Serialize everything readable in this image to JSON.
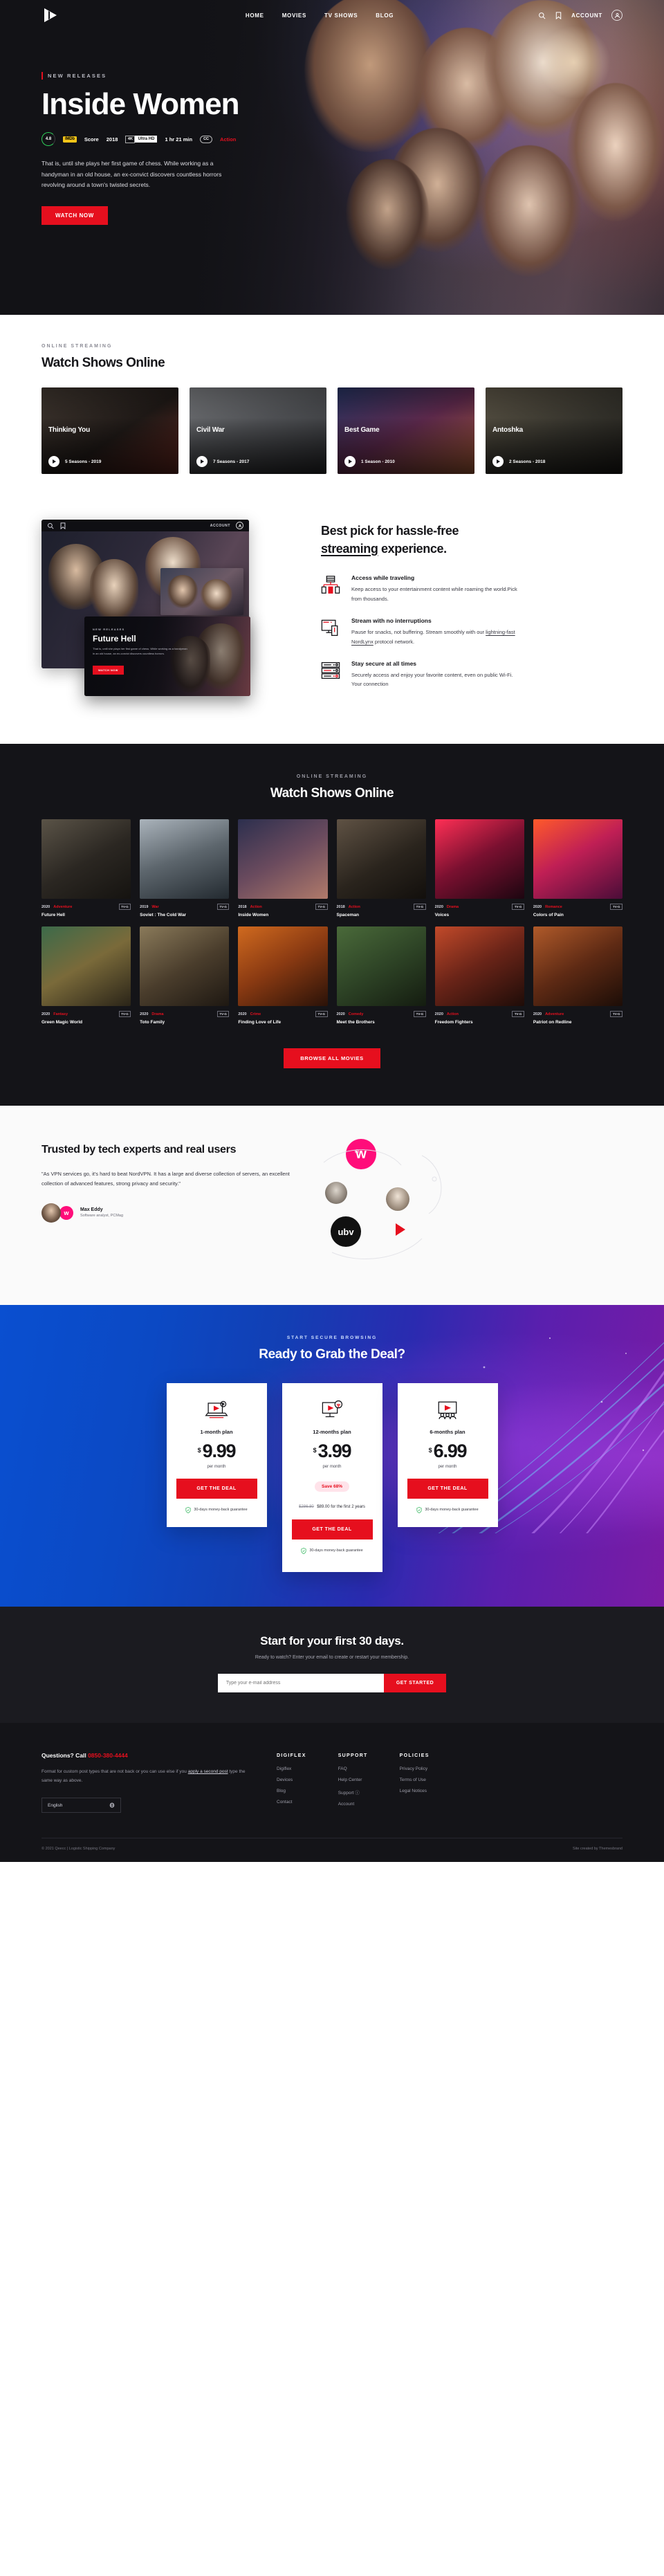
{
  "nav": {
    "logo_name": "play-logo",
    "links": [
      "HOME",
      "MOVIES",
      "TV SHOWS",
      "BLOG"
    ],
    "search_icon": "search-icon",
    "bookmark_icon": "bookmark-icon",
    "account_label": "ACCOUNT",
    "avatar_icon": "user-avatar-icon"
  },
  "hero": {
    "eyebrow": "NEW RELEASES",
    "title": "Inside Women",
    "score": "4.8",
    "imdb_badge": "IMDb",
    "score_label": "Score",
    "year": "2018",
    "quality_key": "4K",
    "quality_value": "Ultra HD",
    "duration": "1 hr 21 min",
    "cc": "CC",
    "genre": "Action",
    "description": "That is, until she plays her first game of chess. While working as a handyman in an old house, an ex-convict discovers countless horrors revolving around a town's twisted secrets.",
    "cta": "WATCH NOW"
  },
  "shows": {
    "eyebrow": "ONLINE STREAMING",
    "title": "Watch Shows Online",
    "cards": [
      {
        "title": "Thinking You",
        "meta": "5 Seasons - 2019"
      },
      {
        "title": "Civil War",
        "meta": "7 Seasons - 2017"
      },
      {
        "title": "Best Game",
        "meta": "1 Season - 2010"
      },
      {
        "title": "Antoshka",
        "meta": "2 Seasons - 2018"
      }
    ]
  },
  "bestpick": {
    "heading_line1": "Best pick for hassle-free",
    "heading_underlined": "streaming",
    "heading_line2_rest": " experience.",
    "device": {
      "search_icon": "search-icon",
      "bookmark_icon": "bookmark-icon",
      "account_label": "ACCOUNT",
      "avatar_icon": "user-avatar-icon",
      "card_eyebrow": "NEW RELEASES",
      "card_title": "Future Hell",
      "card_desc": "That is, until she plays her first game of chess. While working as a handyman in an old house, an ex-convict discovers countless horrors.",
      "card_cta": "WATCH NOW"
    },
    "features": [
      {
        "icon": "network-devices-icon",
        "title": "Access while traveling",
        "text": "Keep access to your entertainment content while roaming the world.Pick from thousands."
      },
      {
        "icon": "monitor-mobile-icon",
        "title": "Stream with no interruptions",
        "text_before": "Pause for snacks, not buffering. Stream smoothly with our ",
        "text_link": "lightning-fast NordLynx",
        "text_after": " protocol network."
      },
      {
        "icon": "server-rack-icon",
        "title": "Stay secure at all times",
        "text": "Securely access and enjoy your favorite content, even on public Wi-Fi. Your connection"
      }
    ]
  },
  "catalog": {
    "eyebrow": "ONLINE STREAMING",
    "title": "Watch Shows Online",
    "items": [
      {
        "year": "2020",
        "genre": "Adventure",
        "rating": "TV-G",
        "name": "Future Hell"
      },
      {
        "year": "2019",
        "genre": "War",
        "rating": "TV-G",
        "name": "Soviet : The Cold War"
      },
      {
        "year": "2018",
        "genre": "Action",
        "rating": "TV-G",
        "name": "Inside Women"
      },
      {
        "year": "2018",
        "genre": "Action",
        "rating": "TV-G",
        "name": "Spaceman"
      },
      {
        "year": "2020",
        "genre": "Drama",
        "rating": "TV-G",
        "name": "Voices"
      },
      {
        "year": "2020",
        "genre": "Romance",
        "rating": "TV-G",
        "name": "Colors of Pain"
      },
      {
        "year": "2020",
        "genre": "Fantasy",
        "rating": "TV-G",
        "name": "Green Magic World"
      },
      {
        "year": "2020",
        "genre": "Drama",
        "rating": "TV-G",
        "name": "Toto Family"
      },
      {
        "year": "2020",
        "genre": "Crime",
        "rating": "TV-G",
        "name": "Finding Love of Life"
      },
      {
        "year": "2020",
        "genre": "Comedy",
        "rating": "TV-G",
        "name": "Meet the Brothers"
      },
      {
        "year": "2020",
        "genre": "Action",
        "rating": "TV-G",
        "name": "Freedom Fighters"
      },
      {
        "year": "2020",
        "genre": "Adventure",
        "rating": "TV-G",
        "name": "Patriot on Redline"
      }
    ],
    "browse_label": "BROWSE ALL MOVIES"
  },
  "trust": {
    "heading": "Trusted by tech experts and real users",
    "quote": "\"As VPN services go, it's hard to beat NordVPN. It has a large and diverse collection of servers, an excellent collection of advanced features, strong privacy and security.\"",
    "person_name": "Max Eddy",
    "person_role": "Software analyst, PCMag",
    "brand_badge_letter": "w",
    "brand_word": "ubv"
  },
  "deal": {
    "eyebrow": "START SECURE BROWSING",
    "title": "Ready to Grab the Deal?",
    "plans": [
      {
        "icon": "laptop-plus-icon",
        "name": "1-month plan",
        "currency": "$",
        "amount": "9.99",
        "per": "per month",
        "cta": "GET THE DEAL",
        "guarantee": "30-days money-back guarantee"
      },
      {
        "icon": "monitor-wifi-icon",
        "name": "12-months plan",
        "currency": "$",
        "amount": "3.99",
        "per": "per month",
        "save": "Save 68%",
        "strike": "$286.80",
        "after": "$89.00 for the first 2 years",
        "cta": "GET THE DEAL",
        "guarantee": "30-days money-back guarantee"
      },
      {
        "icon": "screen-audience-icon",
        "name": "6-months plan",
        "currency": "$",
        "amount": "6.99",
        "per": "per month",
        "cta": "GET THE DEAL",
        "guarantee": "30-days money-back guarantee"
      }
    ]
  },
  "signup": {
    "title": "Start for your first 30 days.",
    "subtitle": "Ready to watch? Enter your email to create or restart your membership.",
    "placeholder": "Type your e-mail address",
    "cta": "GET STARTED"
  },
  "footer": {
    "question": "Questions? Call ",
    "phone": "0850-380-4444",
    "note_before": "Format for custom post types that are not back or you can use else if you ",
    "note_link": "apply a second post",
    "note_after": " type the same way as above.",
    "language": "English",
    "columns": [
      {
        "heading": "DIGIFLEX",
        "links": [
          "Digiflex",
          "Devices",
          "Blog",
          "Contact"
        ]
      },
      {
        "heading": "SUPPORT",
        "links": [
          "FAQ",
          "Help Center",
          "Support ⓘ",
          "Account"
        ]
      },
      {
        "heading": "POLICIES",
        "links": [
          "Privacy Policy",
          "Terms of Use",
          "Legal Notices"
        ]
      }
    ],
    "copyright": "© 2021 Qeecc | Logistic Shipping Company",
    "credit": "Site created by Themesbrand"
  }
}
